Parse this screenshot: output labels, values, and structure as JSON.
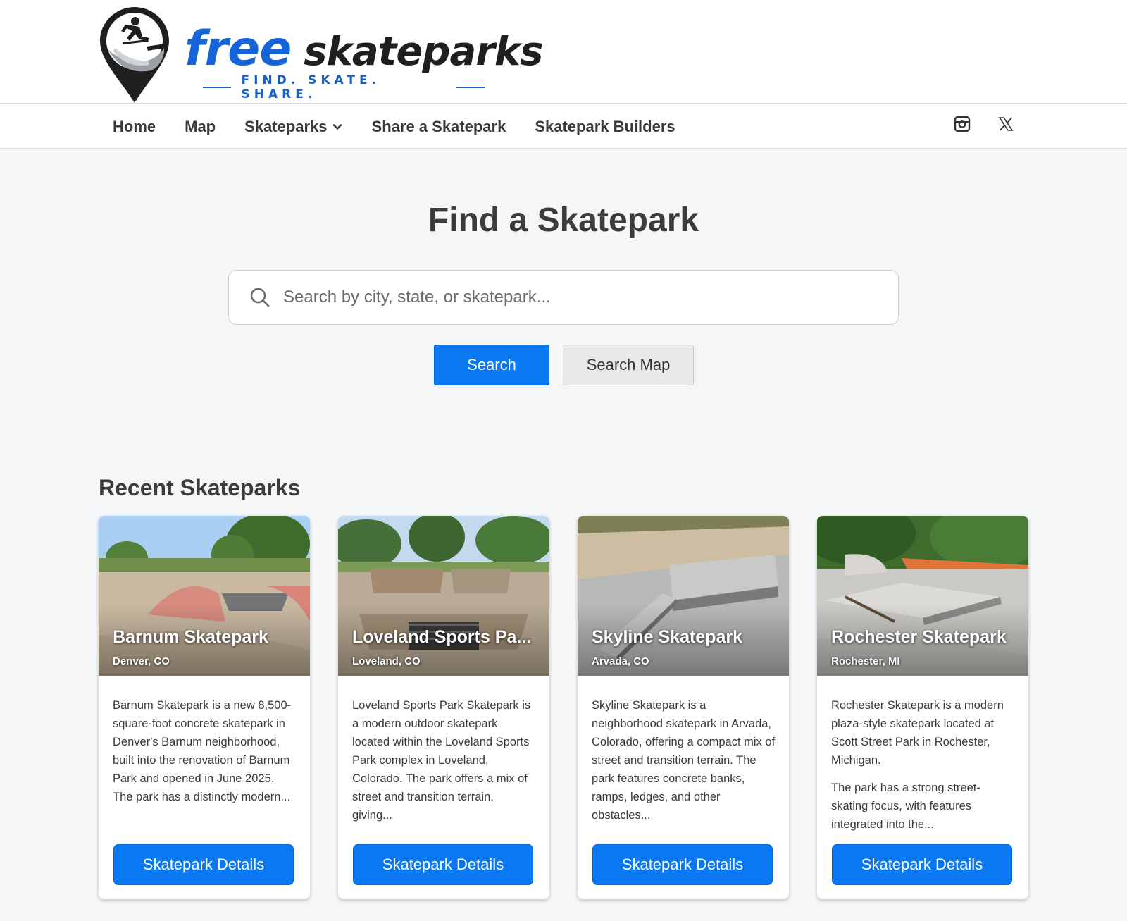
{
  "brand": {
    "word1": "free",
    "word2": "skateparks",
    "tagline": "FIND. SKATE. SHARE."
  },
  "nav": {
    "items": [
      {
        "label": "Home"
      },
      {
        "label": "Map"
      },
      {
        "label": "Skateparks",
        "has_dropdown": true
      },
      {
        "label": "Share a Skatepark"
      },
      {
        "label": "Skatepark Builders"
      }
    ],
    "social_icons": [
      "instagram-icon",
      "x-icon"
    ]
  },
  "hero": {
    "title": "Find a Skatepark",
    "search_placeholder": "Search by city, state, or skatepark...",
    "search_button": "Search",
    "map_button": "Search Map"
  },
  "recent": {
    "title": "Recent Skateparks",
    "cards": [
      {
        "name": "Barnum Skatepark",
        "location": "Denver, CO",
        "paragraphs": [
          "Barnum Skatepark is a new 8,500-square-foot concrete skatepark in Denver's Barnum neighborhood, built into the renovation of Barnum Park and opened in June 2025. The park has a distinctly modern..."
        ],
        "button": "Skatepark Details"
      },
      {
        "name": "Loveland Sports Pa...",
        "location": "Loveland, CO",
        "paragraphs": [
          "Loveland Sports Park Skatepark is a modern outdoor skatepark located within the Loveland Sports Park complex in Loveland, Colorado. The park offers a mix of street and transition terrain, giving..."
        ],
        "button": "Skatepark Details"
      },
      {
        "name": "Skyline Skatepark",
        "location": "Arvada, CO",
        "paragraphs": [
          "Skyline Skatepark is a neighborhood skatepark in Arvada, Colorado, offering a compact mix of street and transition terrain. The park features concrete banks, ramps, ledges, and other obstacles..."
        ],
        "button": "Skatepark Details"
      },
      {
        "name": "Rochester Skatepark",
        "location": "Rochester, MI",
        "paragraphs": [
          "Rochester Skatepark is a modern plaza-style skatepark located at Scott Street Park in Rochester, Michigan.",
          "The park has a strong street-skating focus, with features integrated into the..."
        ],
        "button": "Skatepark Details"
      }
    ]
  },
  "colors": {
    "primary": "#0a78f0",
    "brand_blue": "#1565d8",
    "page_bg": "#f5f6f8",
    "text": "#3c3c3c"
  }
}
